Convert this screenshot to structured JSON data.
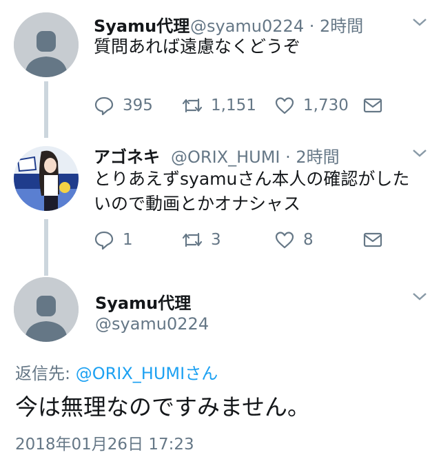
{
  "tweets": [
    {
      "display_name": "Syamu代理",
      "handle": "@syamu0224",
      "sep": "·",
      "time": "2時間",
      "text": "質問あれば遠慮なくどうぞ",
      "replies": "395",
      "retweets": "1,151",
      "likes": "1,730"
    },
    {
      "display_name": "アゴネキ",
      "handle": "@ORIX_HUMI",
      "sep": "·",
      "time": "2時間",
      "text_line1": "とりあえずsyamuさん本人の確認がした",
      "text_line2": "いので動画とかオナシャス",
      "replies": "1",
      "retweets": "3",
      "likes": "8"
    }
  ],
  "main_tweet": {
    "display_name": "Syamu代理",
    "handle": "@syamu0224",
    "reply_label": "返信先: ",
    "reply_mention": "@ORIX_HUMIさん",
    "text": "今は無理なのですみません。",
    "timestamp": "2018年01月26日 17:23"
  },
  "icons": [
    "chevron-down-icon",
    "reply-icon",
    "retweet-icon",
    "like-icon",
    "share-icon",
    "default-avatar-icon"
  ],
  "colors": {
    "accent": "#1da1f2",
    "secondary_text": "#657786",
    "line": "#ccd6dd",
    "avatar_bg": "#c7ccd1"
  }
}
